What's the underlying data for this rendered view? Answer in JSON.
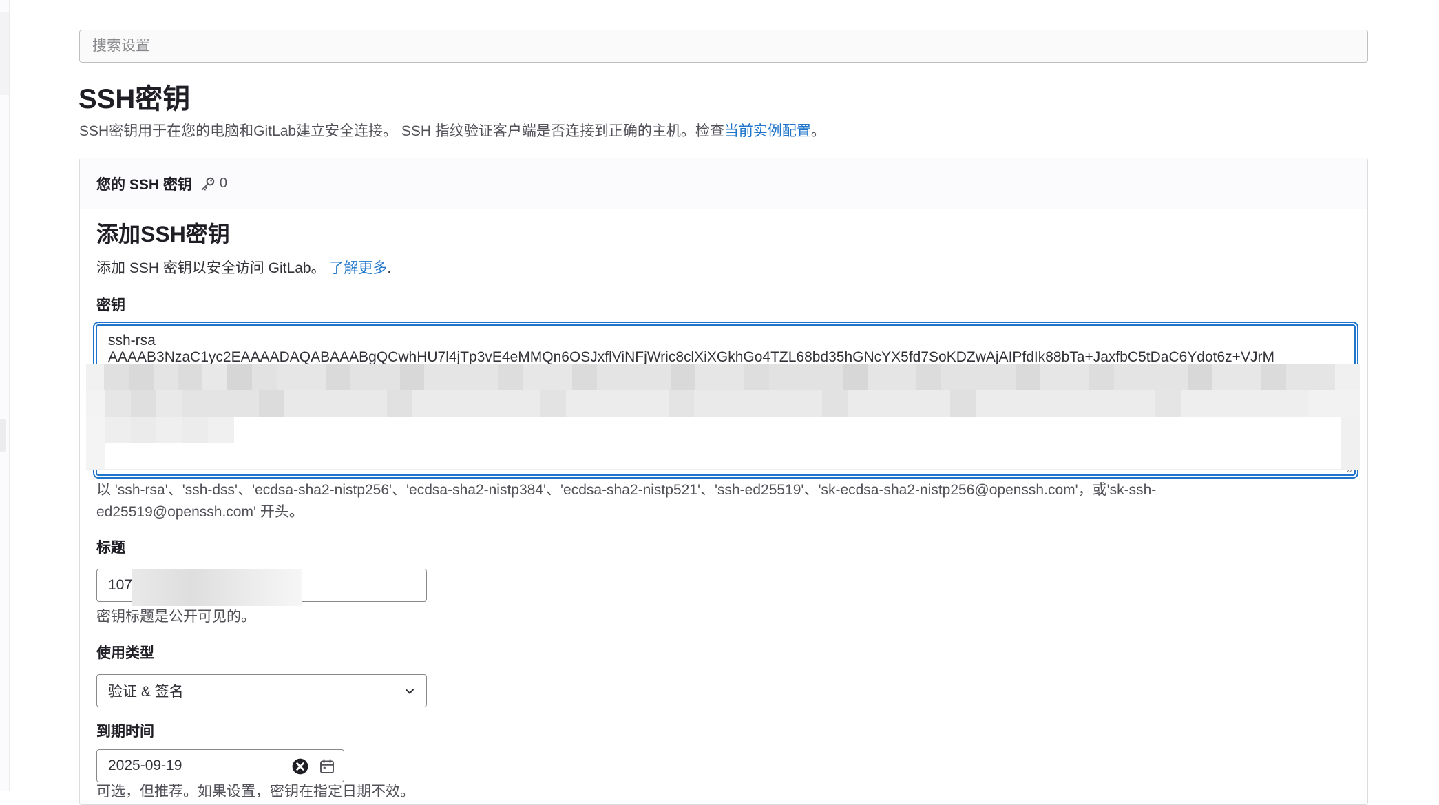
{
  "search": {
    "placeholder": "搜索设置"
  },
  "page": {
    "title": "SSH密钥",
    "description": "SSH密钥用于在您的电脑和GitLab建立安全连接。 SSH 指纹验证客户端是否连接到正确的主机。检查",
    "description_link": "当前实例配置",
    "description_end": "。"
  },
  "card": {
    "header_title": "您的 SSH 密钥",
    "key_count": "0"
  },
  "add_key": {
    "title": "添加SSH密钥",
    "description": "添加 SSH 密钥以安全访问 GitLab。 ",
    "learn_more": "了解更多",
    "learn_more_end": "."
  },
  "key_field": {
    "label": "密钥",
    "line1": "ssh-rsa",
    "line2": "AAAAB3NzaC1yc2EAAAADAQABAAABgQCwhHU7l4jTp3vE4eMMQn6OSJxflViNFjWric8clXiXGkhGo4TZL68bd35hGNcYX5fd7SoKDZwAjAIPfdIk88bTa+JaxfbC5tDaC6Ydot6z+VJrM",
    "help_line1": "以 'ssh-rsa'、'ssh-dss'、'ecdsa-sha2-nistp256'、'ecdsa-sha2-nistp384'、'ecdsa-sha2-nistp521'、'ssh-ed25519'、'sk-ecdsa-sha2-nistp256@openssh.com'，或'sk-ssh-",
    "help_line2": "ed25519@openssh.com' 开头。"
  },
  "title_field": {
    "label": "标题",
    "value": "107",
    "help": "密钥标题是公开可见的。"
  },
  "usage_field": {
    "label": "使用类型",
    "selected": "验证 & 签名"
  },
  "expiry_field": {
    "label": "到期时间",
    "value": "2025-09-19",
    "help": "可选，但推荐。如果设置，密钥在指定日期不效。"
  },
  "colors": {
    "link": "#1f75cb",
    "focus_border": "#1f75cb",
    "text": "#333238"
  }
}
